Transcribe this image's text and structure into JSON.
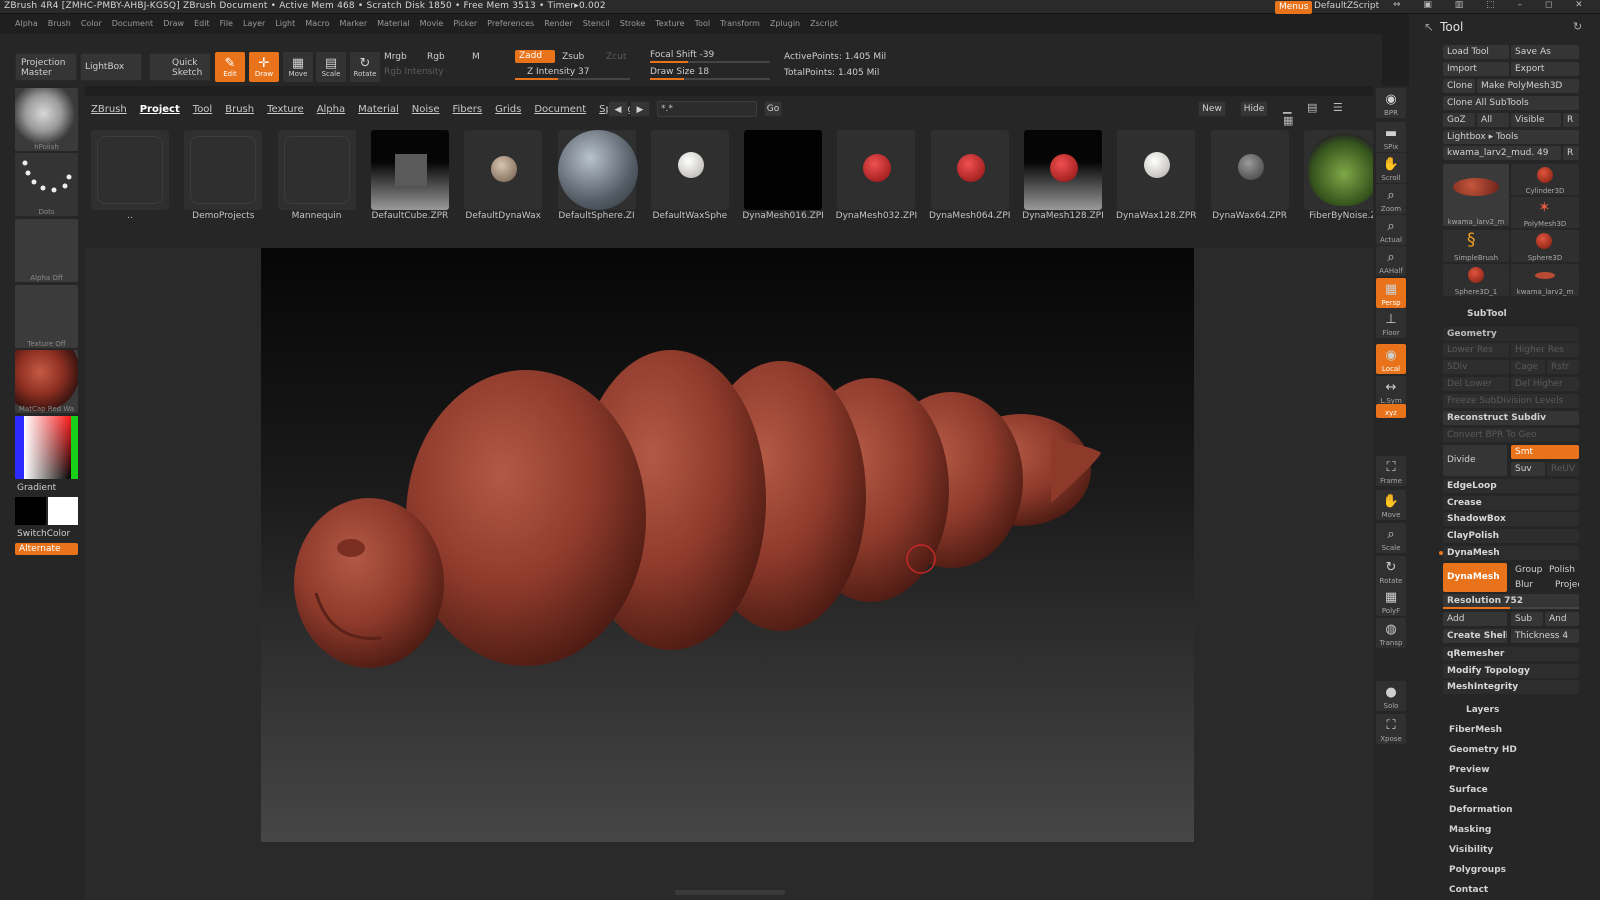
{
  "title_bar": {
    "text": "ZBrush 4R4 [ZMHC-PMBY-AHBJ-KGSQ]    ZBrush Document    • Active Mem 468 • Scratch Disk 1850 • Free Mem 3513 • Timer▸0.002",
    "menus_label": "Menus",
    "script_label": "DefaultZScript"
  },
  "menu_bar": [
    "Alpha",
    "Brush",
    "Color",
    "Document",
    "Draw",
    "Edit",
    "File",
    "Layer",
    "Light",
    "Macro",
    "Marker",
    "Material",
    "Movie",
    "Picker",
    "Preferences",
    "Render",
    "Stencil",
    "Stroke",
    "Texture",
    "Tool",
    "Transform",
    "Zplugin",
    "Zscript"
  ],
  "toolbar": {
    "projection_master": "Projection Master",
    "lightbox": "LightBox",
    "quick_sketch": "Quick Sketch",
    "edit": "Edit",
    "draw": "Draw",
    "move": "Move",
    "scale": "Scale",
    "rotate": "Rotate",
    "mrgb": "Mrgb",
    "rgb": "Rgb",
    "m": "M",
    "rgb_intensity": "Rgb Intensity",
    "zadd": "Zadd",
    "zsub": "Zsub",
    "zcut": "Zcut",
    "z_intensity": "Z Intensity 37",
    "z_intensity_value": 37,
    "focal_shift": "Focal Shift -39",
    "draw_size": "Draw Size 18",
    "active_points": "ActivePoints: 1.405 Mil",
    "total_points": "TotalPoints: 1.405 Mil"
  },
  "left_shelf": {
    "brush": "hPolish",
    "stroke": "Dots",
    "alpha": "Alpha Off",
    "texture": "Texture Off",
    "material": "MatCap Red Wa",
    "gradient": "Gradient",
    "switch_color": "SwitchColor",
    "alternate": "Alternate"
  },
  "lightbox": {
    "tabs": [
      "ZBrush",
      "Project",
      "Tool",
      "Brush",
      "Texture",
      "Alpha",
      "Material",
      "Noise",
      "Fibers",
      "Grids",
      "Document",
      "Spotlight"
    ],
    "active_tab": "Project",
    "search_value": "*.*",
    "go": "Go",
    "new": "New",
    "hide": "Hide",
    "items": [
      {
        "name": "..",
        "kind": "folder"
      },
      {
        "name": "DemoProjects",
        "kind": "folder"
      },
      {
        "name": "Mannequin",
        "kind": "folder"
      },
      {
        "name": "DefaultCube.ZPR",
        "kind": "cube"
      },
      {
        "name": "DefaultDynaWax",
        "kind": "small-tan"
      },
      {
        "name": "DefaultSphere.ZI",
        "kind": "big-gray"
      },
      {
        "name": "DefaultWaxSphe",
        "kind": "small-white"
      },
      {
        "name": "DynaMesh016.ZPI",
        "kind": "black"
      },
      {
        "name": "DynaMesh032.ZPI",
        "kind": "red"
      },
      {
        "name": "DynaMesh064.ZPI",
        "kind": "red"
      },
      {
        "name": "DynaMesh128.ZPI",
        "kind": "red-glow"
      },
      {
        "name": "DynaWax128.ZPR",
        "kind": "small-white"
      },
      {
        "name": "DynaWax64.ZPR",
        "kind": "small-dark"
      },
      {
        "name": "FiberByNoise.Z",
        "kind": "green"
      }
    ]
  },
  "right_shelf": [
    "BPR",
    "SPix",
    "Scroll",
    "Zoom",
    "Actual",
    "AAHalf",
    "Persp",
    "Floor",
    "Local",
    "L.Sym",
    "xyz",
    "Frame",
    "Move",
    "Scale",
    "Rotate",
    "PolyF",
    "Transp",
    "Solo",
    "Xpose"
  ],
  "tool_palette": {
    "title": "Tool",
    "load_tool": "Load Tool",
    "save_as": "Save As",
    "import": "Import",
    "export": "Export",
    "clone": "Clone",
    "make_polymesh": "Make PolyMesh3D",
    "clone_all": "Clone All SubTools",
    "goz": "GoZ",
    "all": "All",
    "visible": "Visible",
    "r": "R",
    "lightbox_tools": "Lightbox ▸ Tools",
    "current_tool": "kwama_larv2_mud. 49",
    "tools": [
      "kwama_larv2_m",
      "Cylinder3D",
      "PolyMesh3D",
      "SimpleBrush",
      "Sphere3D",
      "Sphere3D_1",
      "kwama_larv2_m"
    ],
    "subtool": "SubTool",
    "geometry": "Geometry",
    "lower_res": "Lower Res",
    "higher_res": "Higher Res",
    "sdiv": "SDiv",
    "cage": "Cage",
    "rstr": "Rstr",
    "del_lower": "Del Lower",
    "del_higher": "Del Higher",
    "freeze": "Freeze SubDivision Levels",
    "reconstruct": "Reconstruct Subdiv",
    "convert_bpr": "Convert BPR To Geo",
    "divide": "Divide",
    "smt": "Smt",
    "suv": "Suv",
    "reuv": "ReUV",
    "edgeloop": "EdgeLoop",
    "crease": "Crease",
    "shadowbox": "ShadowBox",
    "claypolish": "ClayPolish",
    "dynamesh_section": "DynaMesh",
    "dynamesh_btn": "DynaMesh",
    "group": "Group",
    "polish": "Polish",
    "blur": "Blur",
    "project": "Projec",
    "resolution": "Resolution 752",
    "resolution_value": 752,
    "add": "Add",
    "sub": "Sub",
    "and": "And",
    "create_shell": "Create Shell",
    "thickness": "Thickness 4",
    "qremesher": "qRemesher",
    "modify_topology": "Modify Topology",
    "meshintegrity": "MeshIntegrity",
    "sections": [
      "Layers",
      "FiberMesh",
      "Geometry HD",
      "Preview",
      "Surface",
      "Deformation",
      "Masking",
      "Visibility",
      "Polygroups",
      "Contact"
    ]
  },
  "colors": {
    "accent": "#e8731b",
    "model": "#9a3a2c",
    "panel": "#262626"
  }
}
